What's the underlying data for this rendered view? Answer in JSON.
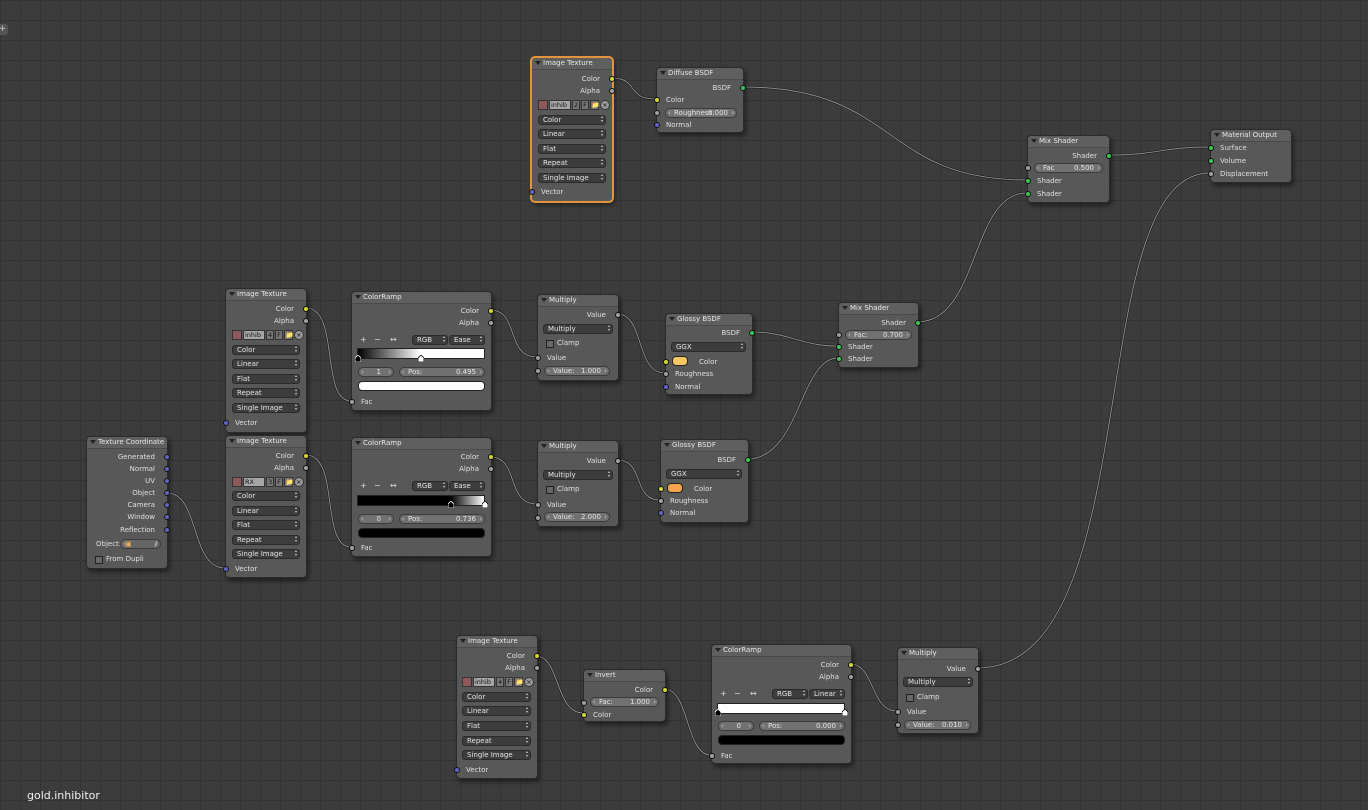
{
  "material_name": "gold.inhibitor",
  "corner_button": "+",
  "nodes": {
    "image_texture_top": {
      "title": "Image Texture",
      "outputs": [
        "Color",
        "Alpha"
      ],
      "image": {
        "name": "inhib",
        "users": "2",
        "fake": "F"
      },
      "dropdowns": [
        "Color",
        "Linear",
        "Flat",
        "Repeat",
        "Single Image"
      ],
      "input": "Vector"
    },
    "diffuse_bsdf": {
      "title": "Diffuse BSDF",
      "output": "BSDF",
      "color_label": "Color",
      "roughness_label": "Roughness:",
      "roughness_value": "0.000",
      "normal_label": "Normal"
    },
    "mix_shader_top": {
      "title": "Mix Shader",
      "output": "Shader",
      "fac_label": "Fac",
      "fac_value": "0.500",
      "inputs": [
        "Shader",
        "Shader"
      ]
    },
    "material_output": {
      "title": "Material Output",
      "inputs": [
        "Surface",
        "Volume",
        "Displacement"
      ]
    },
    "image_texture_mid": {
      "title": "Image Texture",
      "outputs": [
        "Color",
        "Alpha"
      ],
      "image": {
        "name": "inhib",
        "users": "4",
        "fake": "F"
      },
      "dropdowns": [
        "Color",
        "Linear",
        "Flat",
        "Repeat",
        "Single Image"
      ],
      "input": "Vector"
    },
    "colorramp_mid": {
      "title": "ColorRamp",
      "outputs": [
        "Color",
        "Alpha"
      ],
      "tools": [
        "+",
        "−",
        "↔"
      ],
      "mode": "RGB",
      "interp": "Ease",
      "index": "1",
      "pos_label": "Pos:",
      "pos_value": "0.495",
      "input": "Fac",
      "selected_stop_color": "#ffffff"
    },
    "multiply_mid": {
      "title": "Multiply",
      "output": "Value",
      "op": "Multiply",
      "clamp": "Clamp",
      "value_socket": "Value",
      "value_label": "Value:",
      "value": "1.000"
    },
    "glossy_mid": {
      "title": "Glossy BSDF",
      "output": "BSDF",
      "distribution": "GGX",
      "color_label": "Color",
      "roughness_label": "Roughness",
      "normal_label": "Normal",
      "color": "#f6c760"
    },
    "mix_shader_mid": {
      "title": "Mix Shader",
      "output": "Shader",
      "fac_label": "Fac:",
      "fac_value": "0.700",
      "inputs": [
        "Shader",
        "Shader"
      ]
    },
    "texture_coordinate": {
      "title": "Texture Coordinate",
      "outputs": [
        "Generated",
        "Normal",
        "UV",
        "Object",
        "Camera",
        "Window",
        "Reflection"
      ],
      "object_label": "Object:",
      "from_dupli": "From Dupli"
    },
    "image_texture_low": {
      "title": "Image Texture",
      "outputs": [
        "Color",
        "Alpha"
      ],
      "image": {
        "name": "RX",
        "users": "3",
        "fake": "F"
      },
      "dropdowns": [
        "Color",
        "Linear",
        "Flat",
        "Repeat",
        "Single Image"
      ],
      "input": "Vector"
    },
    "colorramp_low": {
      "title": "ColorRamp",
      "outputs": [
        "Color",
        "Alpha"
      ],
      "tools": [
        "+",
        "−",
        "↔"
      ],
      "mode": "RGB",
      "interp": "Ease",
      "index": "0",
      "pos_label": "Pos:",
      "pos_value": "0.736",
      "input": "Fac",
      "selected_stop_color": "#000000"
    },
    "multiply_low": {
      "title": "Multiply",
      "output": "Value",
      "op": "Multiply",
      "clamp": "Clamp",
      "value_socket": "Value",
      "value_label": "Value:",
      "value": "2.000"
    },
    "glossy_low": {
      "title": "Glossy BSDF",
      "output": "BSDF",
      "distribution": "GGX",
      "color_label": "Color",
      "roughness_label": "Roughness",
      "normal_label": "Normal",
      "color": "#f3a34a"
    },
    "image_texture_bottom": {
      "title": "Image Texture",
      "outputs": [
        "Color",
        "Alpha"
      ],
      "image": {
        "name": "inhib",
        "users": "4",
        "fake": "F"
      },
      "dropdowns": [
        "Color",
        "Linear",
        "Flat",
        "Repeat",
        "Single Image"
      ],
      "input": "Vector"
    },
    "invert": {
      "title": "Invert",
      "output": "Color",
      "fac_label": "Fac:",
      "fac_value": "1.000",
      "color_label": "Color"
    },
    "colorramp_bottom": {
      "title": "ColorRamp",
      "outputs": [
        "Color",
        "Alpha"
      ],
      "tools": [
        "+",
        "−",
        "↔"
      ],
      "mode": "RGB",
      "interp": "Linear",
      "index": "0",
      "pos_label": "Pos:",
      "pos_value": "0.000",
      "input": "Fac",
      "selected_stop_color": "#000000"
    },
    "multiply_bottom": {
      "title": "Multiply",
      "output": "Value",
      "op": "Multiply",
      "clamp": "Clamp",
      "value_socket": "Value",
      "value_label": "Value:",
      "value": "0.010"
    }
  },
  "colors": {
    "socket_color": "#d7d638",
    "socket_float": "#a1a1a1",
    "socket_vector": "#6363c7",
    "socket_shader": "#39c754",
    "selected_outline": "#e4953c"
  }
}
